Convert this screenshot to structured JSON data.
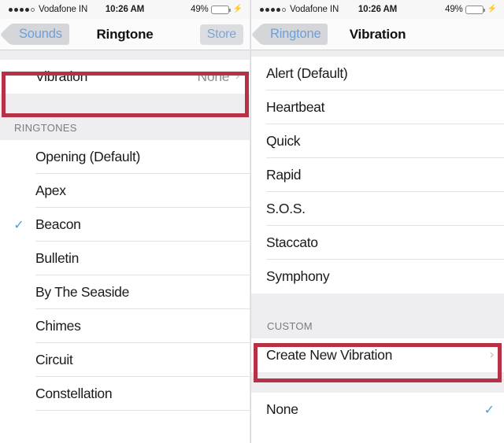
{
  "status_bar": {
    "signal_dots_filled": 4,
    "signal_dots_total": 5,
    "carrier": "Vodafone IN",
    "time": "10:26 AM",
    "battery_percent": "49%",
    "battery_level": 49,
    "charging_icon": "⚡"
  },
  "left_panel": {
    "nav": {
      "back_label": "Sounds",
      "title": "Ringtone",
      "right_button_label": "Store"
    },
    "vibration_row": {
      "label": "Vibration",
      "value": "None",
      "chevron": "›",
      "highlighted": true
    },
    "section_header": "RINGTONES",
    "ringtones": [
      {
        "label": "Opening (Default)",
        "selected": false
      },
      {
        "label": "Apex",
        "selected": false
      },
      {
        "label": "Beacon",
        "selected": true
      },
      {
        "label": "Bulletin",
        "selected": false
      },
      {
        "label": "By The Seaside",
        "selected": false
      },
      {
        "label": "Chimes",
        "selected": false
      },
      {
        "label": "Circuit",
        "selected": false
      },
      {
        "label": "Constellation",
        "selected": false
      }
    ]
  },
  "right_panel": {
    "nav": {
      "back_label": "Ringtone",
      "title": "Vibration"
    },
    "standard_vibrations": [
      {
        "label": "Alert (Default)",
        "selected": false
      },
      {
        "label": "Heartbeat",
        "selected": false
      },
      {
        "label": "Quick",
        "selected": false
      },
      {
        "label": "Rapid",
        "selected": false
      },
      {
        "label": "S.O.S.",
        "selected": false
      },
      {
        "label": "Staccato",
        "selected": false
      },
      {
        "label": "Symphony",
        "selected": false
      }
    ],
    "custom_section_header": "CUSTOM",
    "create_row": {
      "label": "Create New Vibration",
      "chevron": "›",
      "highlighted": true
    },
    "none_row": {
      "label": "None",
      "selected": true,
      "check": "✓"
    }
  },
  "colors": {
    "highlight_border": "#b63046",
    "accent_blue": "#4a9fd8",
    "nav_link": "#7aa5d8",
    "battery_green": "#4cd551",
    "group_bg": "#eeeef0"
  },
  "glyphs": {
    "check": "✓",
    "chevron_right": "›"
  }
}
